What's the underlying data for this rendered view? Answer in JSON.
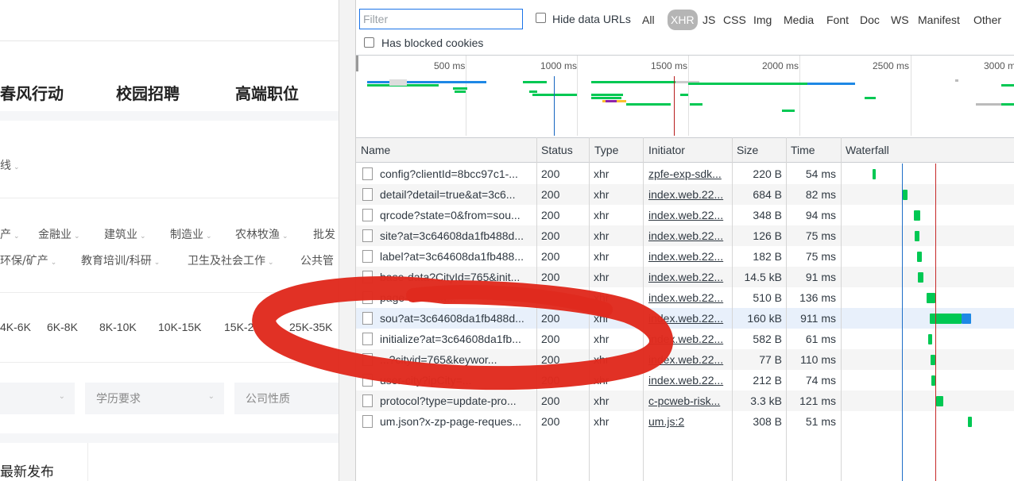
{
  "webpage": {
    "nav": [
      "春风行动",
      "校园招聘",
      "高端职位"
    ],
    "city_tail": "线",
    "industries_row1": [
      "产",
      "金融业",
      "建筑业",
      "制造业",
      "农林牧渔",
      "批发"
    ],
    "industries_row2": [
      "环保/矿产",
      "教育培训/科研",
      "卫生及社会工作",
      "公共管"
    ],
    "salaries": [
      "4K-6K",
      "6K-8K",
      "8K-10K",
      "10K-15K",
      "15K-2",
      "25K-35K"
    ],
    "filters": [
      "学历要求",
      "公司性质"
    ],
    "sort_label": "最新发布"
  },
  "devtools": {
    "filter_placeholder": "Filter",
    "hide_data_urls_label": "Hide data URLs",
    "types": [
      "All",
      "XHR",
      "JS",
      "CSS",
      "Img",
      "Media",
      "Font",
      "Doc",
      "WS",
      "Manifest",
      "Other"
    ],
    "active_type": "XHR",
    "has_blocked_cookies_label": "Has blocked cookies",
    "overview_ticks": [
      "500 ms",
      "1000 ms",
      "1500 ms",
      "2000 ms",
      "2500 ms",
      "3000 ms"
    ],
    "columns": [
      "Name",
      "Status",
      "Type",
      "Initiator",
      "Size",
      "Time",
      "Waterfall"
    ],
    "rows": [
      {
        "name": "config?clientId=8bcc97c1-...",
        "status": "200",
        "type": "xhr",
        "initiator": "zpfe-exp-sdk...",
        "size": "220 B",
        "time": "54 ms"
      },
      {
        "name": "detail?detail=true&at=3c6...",
        "status": "200",
        "type": "xhr",
        "initiator": "index.web.22...",
        "size": "684 B",
        "time": "82 ms"
      },
      {
        "name": "qrcode?state=0&from=sou...",
        "status": "200",
        "type": "xhr",
        "initiator": "index.web.22...",
        "size": "348 B",
        "time": "94 ms"
      },
      {
        "name": "site?at=3c64608da1fb488d...",
        "status": "200",
        "type": "xhr",
        "initiator": "index.web.22...",
        "size": "126 B",
        "time": "75 ms"
      },
      {
        "name": "label?at=3c64608da1fb488...",
        "status": "200",
        "type": "xhr",
        "initiator": "index.web.22...",
        "size": "182 B",
        "time": "75 ms"
      },
      {
        "name": "base-data?CityId=765&init...",
        "status": "200",
        "type": "xhr",
        "initiator": "index.web.22...",
        "size": "14.5 kB",
        "time": "91 ms"
      },
      {
        "name": "page-title?sta...",
        "status": "200",
        "type": "xhr",
        "initiator": "index.web.22...",
        "size": "510 B",
        "time": "136 ms"
      },
      {
        "name": "sou?at=3c64608da1fb488d...",
        "status": "200",
        "type": "xhr",
        "initiator": "index.web.22...",
        "size": "160 kB",
        "time": "911 ms"
      },
      {
        "name": "initialize?at=3c64608da1fb...",
        "status": "200",
        "type": "xhr",
        "initiator": "index.web.22...",
        "size": "582 B",
        "time": "61 ms"
      },
      {
        "name": "...?cityid=765&keywor...",
        "status": "200",
        "type": "xhr",
        "initiator": "index.web.22...",
        "size": "77 B",
        "time": "110 ms"
      },
      {
        "name": "user-city?ipCity=...",
        "status": "200",
        "type": "xhr",
        "initiator": "index.web.22...",
        "size": "212 B",
        "time": "74 ms"
      },
      {
        "name": "protocol?type=update-pro...",
        "status": "200",
        "type": "xhr",
        "initiator": "c-pcweb-risk...",
        "size": "3.3 kB",
        "time": "121 ms"
      },
      {
        "name": "um.json?x-zp-page-reques...",
        "status": "200",
        "type": "xhr",
        "initiator": "um.js:2",
        "size": "308 B",
        "time": "51 ms"
      }
    ],
    "colors": {
      "waiting_green": "#00c853",
      "download_blue": "#1e88e5",
      "dom_loaded_line": "#1565c0",
      "load_line": "#b71c1c",
      "annotation_red": "#e02a1e"
    }
  }
}
